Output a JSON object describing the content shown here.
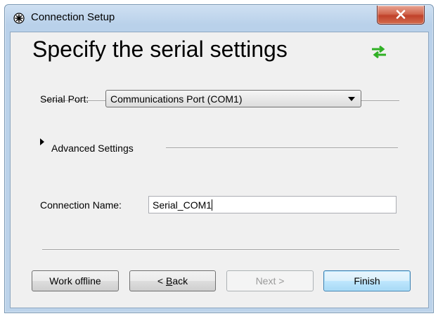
{
  "window": {
    "title": "Connection Setup"
  },
  "header": {
    "heading": "Specify the serial settings"
  },
  "serial_port": {
    "label": "Serial Port:",
    "selected": "Communications Port (COM1)"
  },
  "advanced": {
    "label": "Advanced Settings"
  },
  "connection_name": {
    "label": "Connection Name:",
    "value": "Serial_COM1"
  },
  "buttons": {
    "work_offline": "Work offline",
    "back_prefix": "< ",
    "back_mnemonic": "B",
    "back_rest": "ack",
    "next": "Next >",
    "finish": "Finish"
  },
  "icons": {
    "app": "star-circle-icon",
    "sync": "sync-arrows-icon",
    "close": "close-icon"
  },
  "colors": {
    "sync_icon": "#2fb024",
    "close_button": "#c7452d"
  }
}
